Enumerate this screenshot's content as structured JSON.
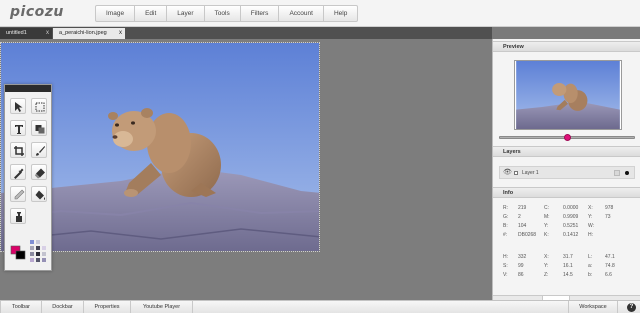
{
  "app": {
    "logo_text": "picozu"
  },
  "menu": [
    "Image",
    "Edit",
    "Layer",
    "Tools",
    "Filters",
    "Account",
    "Help"
  ],
  "tabs": [
    {
      "label": "untitled1",
      "close": "x"
    },
    {
      "label": "a_peraichi-lion.jpeg",
      "close": "x"
    }
  ],
  "panel": {
    "preview_title": "Preview",
    "zoom_slider_fraction": 0.5,
    "layers_title": "Layers",
    "layer": {
      "eye": "👁",
      "name": "Layer 1"
    },
    "info_title": "Info",
    "info_rows_top": [
      [
        "R:",
        "219",
        "C:",
        "0.0000",
        "X:",
        "978"
      ],
      [
        "G:",
        "2",
        "M:",
        "0.9909",
        "Y:",
        "73"
      ],
      [
        "B:",
        "104",
        "Y:",
        "0.5251",
        "W:",
        ""
      ],
      [
        "#:",
        "DB0268",
        "K:",
        "0.1412",
        "H:",
        ""
      ]
    ],
    "info_rows_bottom": [
      [
        "H:",
        "332",
        "X:",
        "31.7",
        "L:",
        "47.1"
      ],
      [
        "S:",
        "99",
        "Y:",
        "16.1",
        "a:",
        "74.8"
      ],
      [
        "V:",
        "86",
        "Z:",
        "14.5",
        "b:",
        "6.6"
      ]
    ]
  },
  "bottom": {
    "buttons": [
      "Toolbar",
      "Dockbar",
      "Properties",
      "Youtube Player"
    ],
    "workspace": "Workspace"
  },
  "colors": {
    "foreground": "#DB0268",
    "background": "#000000",
    "accent": "#e0117a"
  },
  "tool_icons": [
    "move-tool-icon",
    "marquee-tool-icon",
    "text-tool-icon",
    "shape-tool-icon",
    "crop-tool-icon",
    "brush-tool-icon",
    "eyedropper-tool-icon",
    "eraser-tool-icon",
    "smudge-tool-icon",
    "fill-tool-icon",
    "clone-tool-icon"
  ]
}
